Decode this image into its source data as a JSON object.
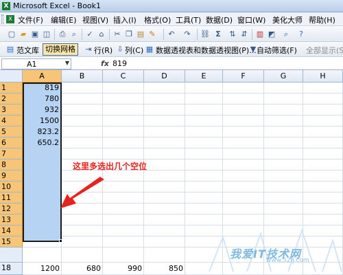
{
  "window": {
    "title": "Microsoft Excel - Book1",
    "app_icon": "X"
  },
  "menu": {
    "items": [
      "文件(F)",
      "编辑(E)",
      "视图(V)",
      "插入(I)",
      "格式(O)",
      "工具(T)",
      "数据(D)",
      "窗口(W)",
      "美化大师",
      "帮助(H)"
    ]
  },
  "toolbar2": {
    "library_label": "范文库",
    "grid_toggle_label": "切换网格",
    "row_label": "行(R)",
    "col_label": "列(C)",
    "pivot_label": "数据透视表和数据透视图(P)...",
    "autofilter_label": "自动筛选(F)",
    "show_all_label": "全部显示(S)"
  },
  "formula_bar": {
    "name_box": "A1",
    "fx": "fx",
    "value": "819"
  },
  "grid": {
    "columns": [
      "A",
      "B",
      "C",
      "D",
      "E",
      "F",
      "G",
      "H"
    ],
    "selected_column": "A",
    "rows": [
      "1",
      "2",
      "3",
      "4",
      "5",
      "6",
      "7",
      "8",
      "9",
      "10",
      "11",
      "12",
      "13",
      "14",
      "15",
      "18"
    ],
    "column_a_values": [
      "819",
      "780",
      "932",
      "1500",
      "823.2",
      "650.2"
    ],
    "row18_values": [
      "1200",
      "680",
      "990",
      "850"
    ]
  },
  "annotation": {
    "text": "这里多选出几个空位",
    "color": "#e8231e"
  },
  "watermark": {
    "text": "我爱IT技术网",
    "url": "www.52ij.com"
  },
  "colors": {
    "selection_fill": "#b7d3f3",
    "header_selected": "#f7c578"
  }
}
